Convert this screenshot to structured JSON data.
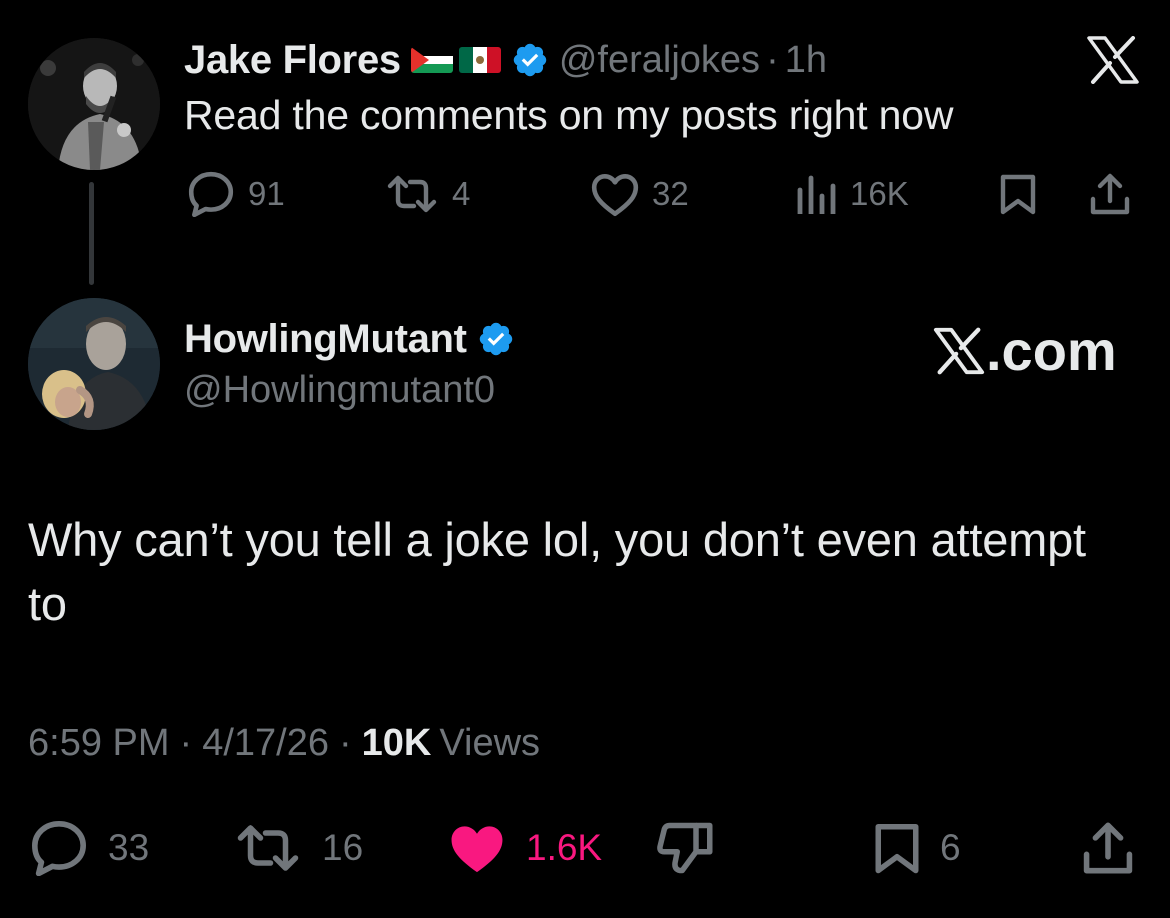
{
  "colors": {
    "background": "#000000",
    "text": "#e7e9ea",
    "muted": "#71767b",
    "verified": "#1d9bf0",
    "like": "#f91880",
    "thread_line": "#333639"
  },
  "parent_tweet": {
    "name": "Jake Flores",
    "flags": [
      "palestine-flag",
      "mexico-flag"
    ],
    "handle": "@feraljokes",
    "separator": "·",
    "time": "1h",
    "text": "Read the comments on my posts right now",
    "stats": {
      "replies": "91",
      "reposts": "4",
      "likes": "32",
      "views": "16K"
    },
    "icons": [
      "reply-icon",
      "repost-icon",
      "like-icon",
      "views-icon",
      "bookmark-icon",
      "share-icon"
    ]
  },
  "x_logo": "X",
  "reply_tweet": {
    "name": "HowlingMutant",
    "handle": "@Howlingmutant0",
    "text": "Why can’t you tell a joke lol, you don’t even attempt to",
    "time": "6:59 PM",
    "separator": "·",
    "date": "4/17/26",
    "views_count": "10K",
    "views_label": "Views",
    "stats": {
      "replies": "33",
      "reposts": "16",
      "likes": "1.6K",
      "bookmarks": "6"
    }
  },
  "watermark": {
    "text": ".com"
  }
}
